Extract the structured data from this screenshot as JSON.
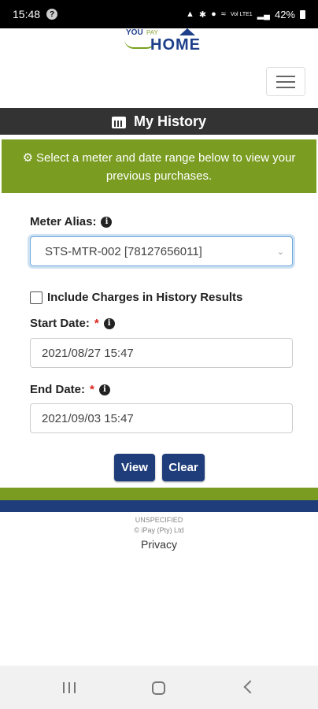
{
  "status_bar": {
    "time": "15:48",
    "notification_badge": "?",
    "signal_label": "Vol LTE1",
    "battery": "42%"
  },
  "logo": {
    "you": "YOU",
    "middle": "PAY",
    "home": "HOME"
  },
  "page": {
    "title": "My History",
    "banner": "Select a meter and date range below to view your previous purchases."
  },
  "form": {
    "meter_alias_label": "Meter Alias:",
    "meter_alias_value": "STS-MTR-002 [78127656011]",
    "include_charges_label": "Include Charges in History Results",
    "include_charges_checked": false,
    "start_date_label": "Start Date:",
    "start_date_value": "2021/08/27 15:47",
    "end_date_label": "End Date:",
    "end_date_value": "2021/09/03 15:47",
    "required_marker": "*",
    "view_button": "View",
    "clear_button": "Clear"
  },
  "footer": {
    "line1": "UNSPECIFIED",
    "line2": "© iPay (Pty) Ltd",
    "privacy": "Privacy"
  },
  "colors": {
    "banner_green": "#7a9c21",
    "title_bar": "#333333",
    "button_blue": "#1f3d7a",
    "required_red": "#d9251c"
  },
  "icons": {
    "title": "calendar-icon",
    "banner": "gear-icon",
    "info": "info-circle-icon",
    "menu": "hamburger-icon"
  }
}
